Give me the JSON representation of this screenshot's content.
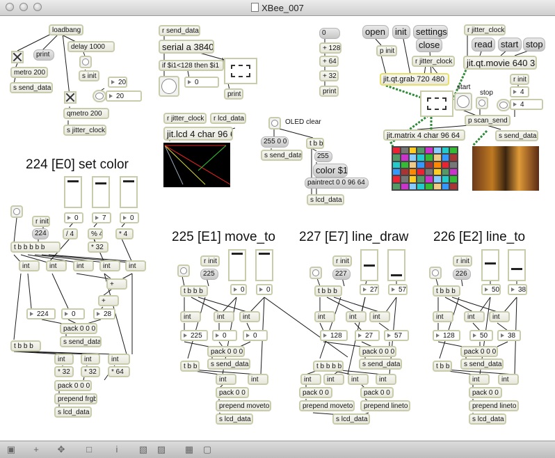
{
  "window": {
    "title": "XBee_007"
  },
  "headings": {
    "set_color": "224 [E0] set color",
    "move_to": "225 [E1] move_to",
    "line_draw": "227 [E7] line_draw",
    "line_to": "226 [E2] line_to"
  },
  "labels": {
    "oled_clear": "OLED clear",
    "start": "start",
    "stop": "stop"
  },
  "objects": {
    "loadbang": "loadbang",
    "print1": "print",
    "delay": "delay 1000",
    "metro": "metro 200",
    "s_send_data_1": "s send_data",
    "s_init": "s init",
    "qmetro": "qmetro 200",
    "s_jitter_clock": "s jitter_clock",
    "r_send_data": "r send_data",
    "serial": "serial a 38400",
    "if_expr": "if $i1<128 then $i1",
    "print2": "print",
    "r_jitter_clock_1": "r jitter_clock",
    "r_lcd_data": "r lcd_data",
    "jit_lcd": "jit.lcd 4 char 96 64",
    "msg_255_0_0": "255 0 0",
    "s_send_data_2": "s send_data",
    "tbb": "t b b",
    "msg_255": "255",
    "color_msg": "color $1",
    "paintrect": "paintrect 0 0 96 64",
    "s_lcd_data_top": "s lcd_data",
    "msg_0": "0",
    "plus128": "+ 128",
    "plus64": "+ 64",
    "plus32": "+ 32",
    "print3": "print",
    "open": "open",
    "init": "init",
    "settings": "settings",
    "p_init": "p init",
    "close": "close",
    "r_jitter_clock_2": "r jitter_clock",
    "grab": "jit.qt.grab 720 480",
    "r_jitter_clock_3": "r jitter_clock",
    "read": "read",
    "startmsg": "start",
    "stopmsg": "stop",
    "movie": "jit.qt.movie 640 380",
    "r_init_top": "r init",
    "p_scan_send": "p scan_send",
    "jit_matrix": "jit.matrix 4 char 96 64",
    "s_send_data_3": "s send_data",
    "r_init_1": "r init",
    "msg_224": "224",
    "tbbbbbb": "t b b b b b",
    "div4": "/ 4",
    "mod4": "% 4",
    "mul4": "* 4",
    "mul32a": "* 32",
    "plus_a": "+",
    "plus_b": "+",
    "int": "int",
    "msg_28": "28",
    "pack000a": "pack 0 0 0",
    "s_send_data_4": "s send_data",
    "tbbb": "t b b b",
    "mul32b": "* 32",
    "mul32c": "* 32",
    "mul64": "* 64",
    "pack000b": "pack 0 0 0",
    "prepend_frgb": "prepend frgb",
    "s_lcd_data_1": "s lcd_data",
    "r_init_2": "r init",
    "msg_225": "225",
    "tbbbb": "t b b b",
    "tbb2": "t b b",
    "pack000": "pack 0 0 0",
    "s_send_data_5": "s send_data",
    "pack00": "pack 0 0",
    "prepend_moveto": "prepend moveto",
    "s_lcd_data_2": "s lcd_data",
    "r_init_3": "r init",
    "msg_227": "227",
    "tbbbbb": "t b b b b",
    "prepend_lineto": "prepend lineto",
    "s_lcd_data_3": "s lcd_data",
    "r_init_4": "r init",
    "msg_226": "226",
    "s_lcd_data_4": "s lcd_data",
    "s_send_data_6": "s send_data"
  },
  "numbers": {
    "n0a": "0",
    "n20a": "20",
    "n20b": "20",
    "n4a": "4",
    "n4b": "4",
    "color_r": "0",
    "color_g": "7",
    "color_b": "0",
    "nb224": "224",
    "nb0": "0",
    "nb28": "28",
    "mv_x": "0",
    "mv_y": "0",
    "mv_cmd": "225",
    "mv_xo": "0",
    "mv_yo": "0",
    "ld_x": "27",
    "ld_y": "57",
    "ld_cmd": "128",
    "ld_xo": "27",
    "ld_yo": "57",
    "lt_x": "50",
    "lt_y": "38",
    "lt_cmd": "128",
    "lt_xo": "50",
    "lt_yo": "38"
  },
  "sliders": {
    "r": 0.97,
    "g": 0.88,
    "b": 0.97,
    "mv_x": 1.0,
    "mv_y": 1.0,
    "ld_x": 0.53,
    "ld_y": 0.15,
    "lt_x": 0.6,
    "lt_y": 0.4
  },
  "toolbar": [
    "lock-icon",
    "add-object-icon",
    "move-icon",
    "presentation-icon",
    "info-icon",
    "snap-icon",
    "grid-icon",
    "zoom-icon"
  ],
  "colors": {
    "accent_wire": "#2f8a3a",
    "box_border": "#c9ccab",
    "highlight": "#f0e68c"
  }
}
